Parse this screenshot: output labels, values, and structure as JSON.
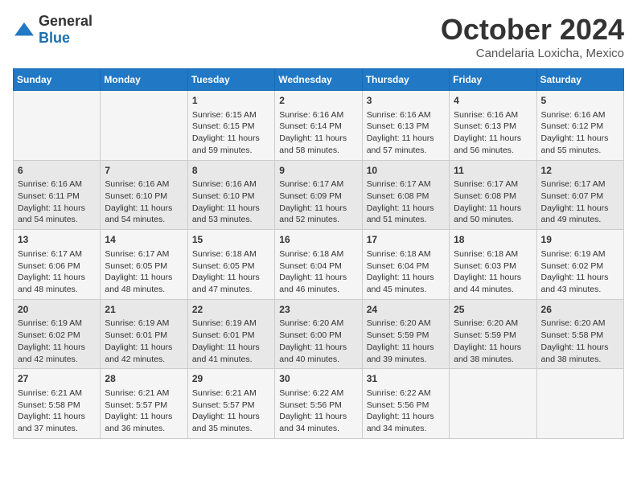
{
  "header": {
    "logo_general": "General",
    "logo_blue": "Blue",
    "month": "October 2024",
    "location": "Candelaria Loxicha, Mexico"
  },
  "days_of_week": [
    "Sunday",
    "Monday",
    "Tuesday",
    "Wednesday",
    "Thursday",
    "Friday",
    "Saturday"
  ],
  "weeks": [
    [
      {
        "day": "",
        "content": ""
      },
      {
        "day": "",
        "content": ""
      },
      {
        "day": "1",
        "content": "Sunrise: 6:15 AM\nSunset: 6:15 PM\nDaylight: 11 hours and 59 minutes."
      },
      {
        "day": "2",
        "content": "Sunrise: 6:16 AM\nSunset: 6:14 PM\nDaylight: 11 hours and 58 minutes."
      },
      {
        "day": "3",
        "content": "Sunrise: 6:16 AM\nSunset: 6:13 PM\nDaylight: 11 hours and 57 minutes."
      },
      {
        "day": "4",
        "content": "Sunrise: 6:16 AM\nSunset: 6:13 PM\nDaylight: 11 hours and 56 minutes."
      },
      {
        "day": "5",
        "content": "Sunrise: 6:16 AM\nSunset: 6:12 PM\nDaylight: 11 hours and 55 minutes."
      }
    ],
    [
      {
        "day": "6",
        "content": "Sunrise: 6:16 AM\nSunset: 6:11 PM\nDaylight: 11 hours and 54 minutes."
      },
      {
        "day": "7",
        "content": "Sunrise: 6:16 AM\nSunset: 6:10 PM\nDaylight: 11 hours and 54 minutes."
      },
      {
        "day": "8",
        "content": "Sunrise: 6:16 AM\nSunset: 6:10 PM\nDaylight: 11 hours and 53 minutes."
      },
      {
        "day": "9",
        "content": "Sunrise: 6:17 AM\nSunset: 6:09 PM\nDaylight: 11 hours and 52 minutes."
      },
      {
        "day": "10",
        "content": "Sunrise: 6:17 AM\nSunset: 6:08 PM\nDaylight: 11 hours and 51 minutes."
      },
      {
        "day": "11",
        "content": "Sunrise: 6:17 AM\nSunset: 6:08 PM\nDaylight: 11 hours and 50 minutes."
      },
      {
        "day": "12",
        "content": "Sunrise: 6:17 AM\nSunset: 6:07 PM\nDaylight: 11 hours and 49 minutes."
      }
    ],
    [
      {
        "day": "13",
        "content": "Sunrise: 6:17 AM\nSunset: 6:06 PM\nDaylight: 11 hours and 48 minutes."
      },
      {
        "day": "14",
        "content": "Sunrise: 6:17 AM\nSunset: 6:05 PM\nDaylight: 11 hours and 48 minutes."
      },
      {
        "day": "15",
        "content": "Sunrise: 6:18 AM\nSunset: 6:05 PM\nDaylight: 11 hours and 47 minutes."
      },
      {
        "day": "16",
        "content": "Sunrise: 6:18 AM\nSunset: 6:04 PM\nDaylight: 11 hours and 46 minutes."
      },
      {
        "day": "17",
        "content": "Sunrise: 6:18 AM\nSunset: 6:04 PM\nDaylight: 11 hours and 45 minutes."
      },
      {
        "day": "18",
        "content": "Sunrise: 6:18 AM\nSunset: 6:03 PM\nDaylight: 11 hours and 44 minutes."
      },
      {
        "day": "19",
        "content": "Sunrise: 6:19 AM\nSunset: 6:02 PM\nDaylight: 11 hours and 43 minutes."
      }
    ],
    [
      {
        "day": "20",
        "content": "Sunrise: 6:19 AM\nSunset: 6:02 PM\nDaylight: 11 hours and 42 minutes."
      },
      {
        "day": "21",
        "content": "Sunrise: 6:19 AM\nSunset: 6:01 PM\nDaylight: 11 hours and 42 minutes."
      },
      {
        "day": "22",
        "content": "Sunrise: 6:19 AM\nSunset: 6:01 PM\nDaylight: 11 hours and 41 minutes."
      },
      {
        "day": "23",
        "content": "Sunrise: 6:20 AM\nSunset: 6:00 PM\nDaylight: 11 hours and 40 minutes."
      },
      {
        "day": "24",
        "content": "Sunrise: 6:20 AM\nSunset: 5:59 PM\nDaylight: 11 hours and 39 minutes."
      },
      {
        "day": "25",
        "content": "Sunrise: 6:20 AM\nSunset: 5:59 PM\nDaylight: 11 hours and 38 minutes."
      },
      {
        "day": "26",
        "content": "Sunrise: 6:20 AM\nSunset: 5:58 PM\nDaylight: 11 hours and 38 minutes."
      }
    ],
    [
      {
        "day": "27",
        "content": "Sunrise: 6:21 AM\nSunset: 5:58 PM\nDaylight: 11 hours and 37 minutes."
      },
      {
        "day": "28",
        "content": "Sunrise: 6:21 AM\nSunset: 5:57 PM\nDaylight: 11 hours and 36 minutes."
      },
      {
        "day": "29",
        "content": "Sunrise: 6:21 AM\nSunset: 5:57 PM\nDaylight: 11 hours and 35 minutes."
      },
      {
        "day": "30",
        "content": "Sunrise: 6:22 AM\nSunset: 5:56 PM\nDaylight: 11 hours and 34 minutes."
      },
      {
        "day": "31",
        "content": "Sunrise: 6:22 AM\nSunset: 5:56 PM\nDaylight: 11 hours and 34 minutes."
      },
      {
        "day": "",
        "content": ""
      },
      {
        "day": "",
        "content": ""
      }
    ]
  ]
}
